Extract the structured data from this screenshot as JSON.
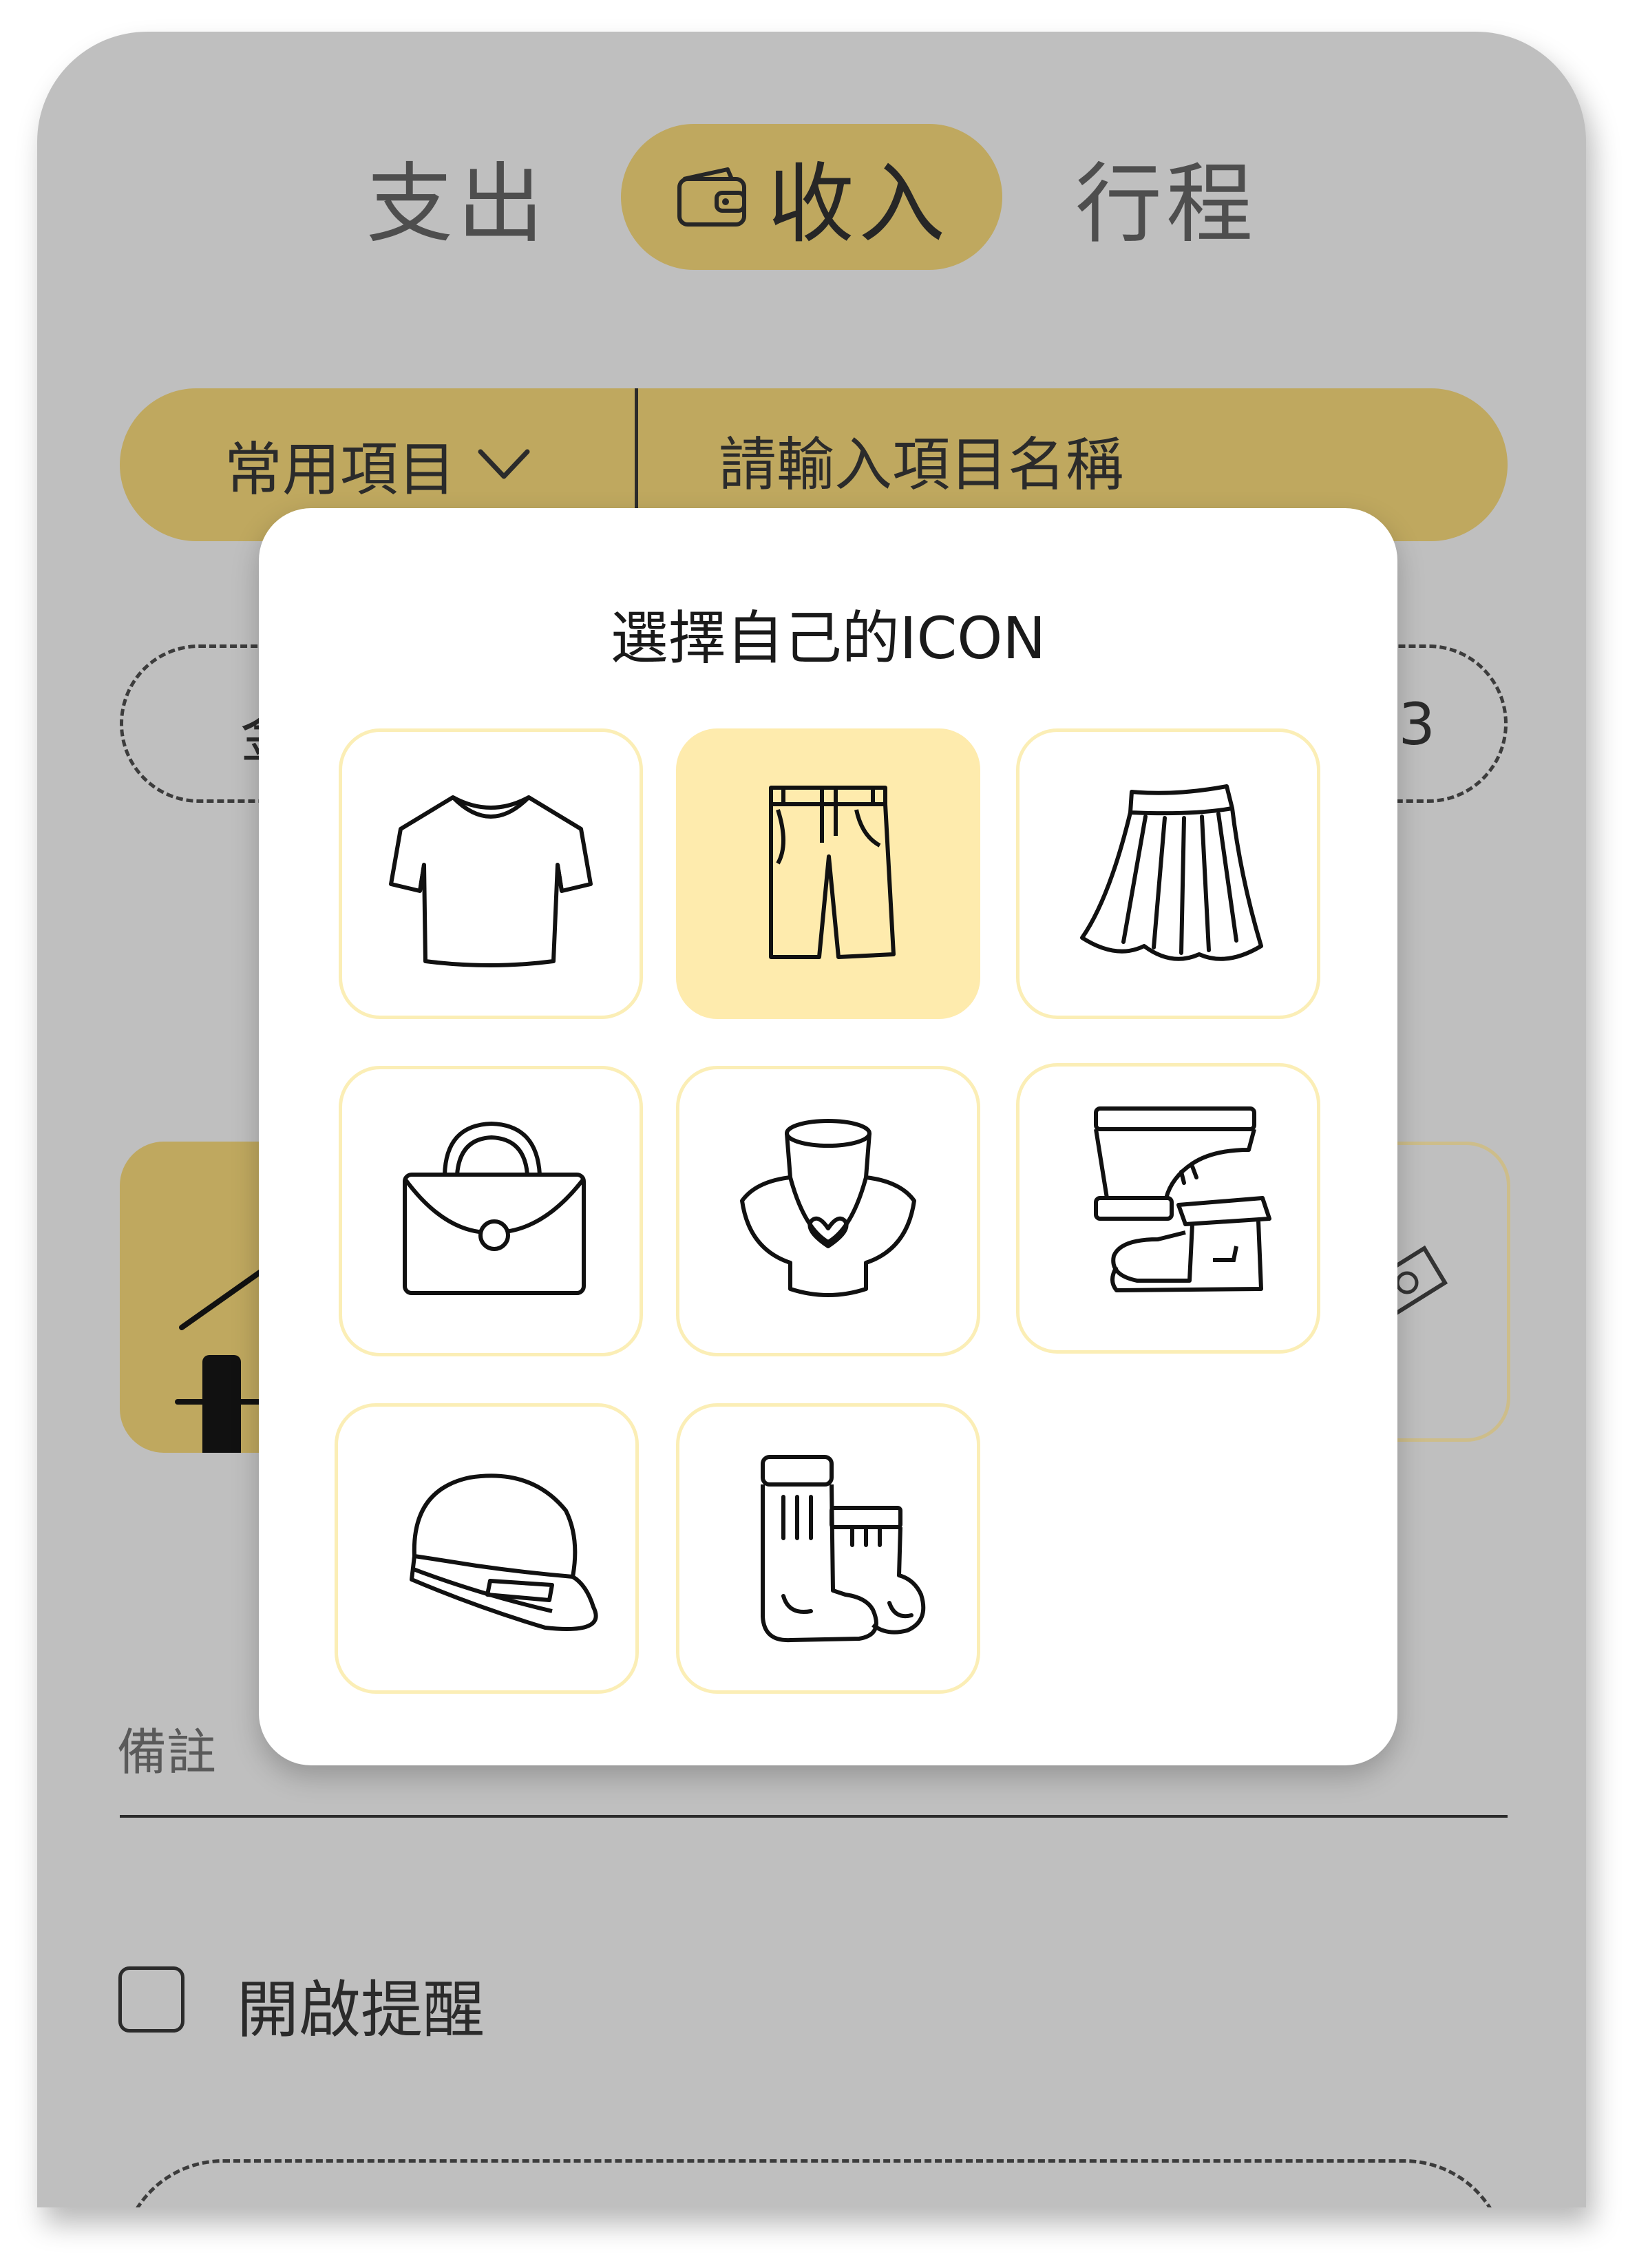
{
  "tabs": [
    {
      "label": "支出",
      "active": false
    },
    {
      "label": "收入",
      "active": true,
      "icon": "wallet-icon"
    },
    {
      "label": "行程",
      "active": false
    }
  ],
  "search": {
    "dropdown_label": "常用項目",
    "placeholder": "請輸入項目名稱"
  },
  "amount": {
    "label": "金",
    "value": "3"
  },
  "note": {
    "label": "備註"
  },
  "reminder": {
    "label": "開啟提醒",
    "checked": false
  },
  "modal": {
    "title": "選擇自己的ICON",
    "icons": [
      {
        "name": "tshirt-icon",
        "selected": false
      },
      {
        "name": "shorts-icon",
        "selected": true
      },
      {
        "name": "skirt-icon",
        "selected": false
      },
      {
        "name": "handbag-icon",
        "selected": false
      },
      {
        "name": "necklace-icon",
        "selected": false
      },
      {
        "name": "shoes-icon",
        "selected": false
      },
      {
        "name": "cap-icon",
        "selected": false
      },
      {
        "name": "socks-icon",
        "selected": false
      }
    ]
  },
  "colors": {
    "overlay_gray": "#bfbfbf",
    "accent_gold": "#bfa85f",
    "tile_border": "#fbeeb6",
    "tile_selected": "#feebad"
  }
}
